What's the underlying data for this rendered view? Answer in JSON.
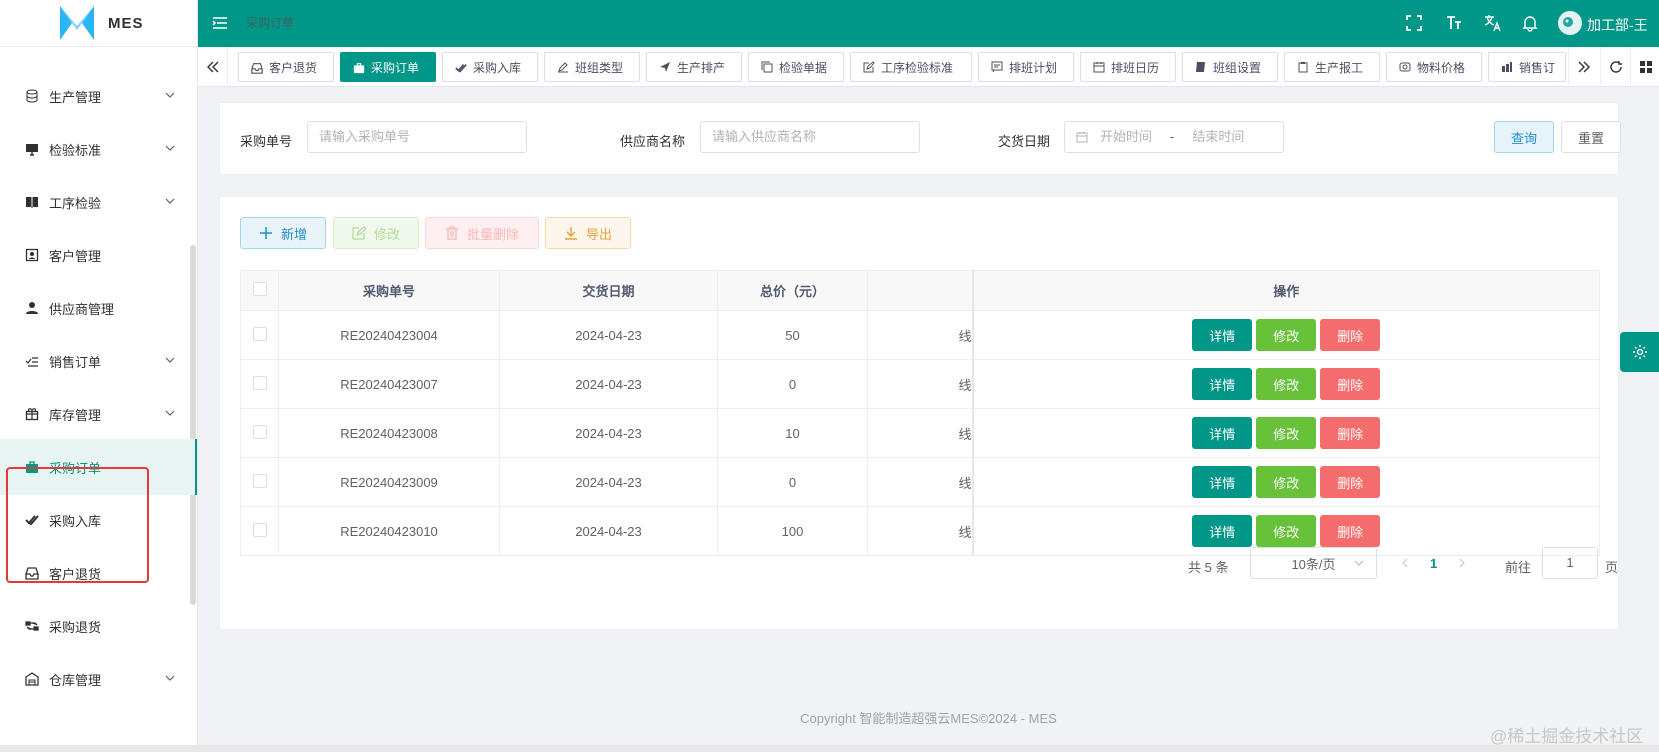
{
  "app": {
    "logo_text": "MES",
    "breadcrumb": "采购订单"
  },
  "user": {
    "name": "加工部-王"
  },
  "colors": {
    "primary": "#009688",
    "success": "#67c23a",
    "danger": "#f56c6c",
    "warning": "#e6a23c"
  },
  "sidebar": {
    "items": [
      {
        "label": "生产管理",
        "icon": "database-icon",
        "has_children": true
      },
      {
        "label": "检验标准",
        "icon": "monitor-icon",
        "has_children": true
      },
      {
        "label": "工序检验",
        "icon": "book-icon",
        "has_children": true
      },
      {
        "label": "客户管理",
        "icon": "contact-card-icon",
        "has_children": false
      },
      {
        "label": "供应商管理",
        "icon": "user-icon",
        "has_children": false
      },
      {
        "label": "销售订单",
        "icon": "list-check-icon",
        "has_children": true
      },
      {
        "label": "库存管理",
        "icon": "gift-box-icon",
        "has_children": true
      },
      {
        "label": "采购订单",
        "icon": "briefcase-icon",
        "has_children": false,
        "active": true
      },
      {
        "label": "采购入库",
        "icon": "double-check-icon",
        "has_children": false
      },
      {
        "label": "客户退货",
        "icon": "inbox-icon",
        "has_children": false
      },
      {
        "label": "采购退货",
        "icon": "swap-icon",
        "has_children": false
      },
      {
        "label": "仓库管理",
        "icon": "warehouse-icon",
        "has_children": true
      }
    ]
  },
  "tabs": [
    {
      "label": "客户退货",
      "icon": "inbox-icon"
    },
    {
      "label": "采购订单",
      "icon": "briefcase-icon",
      "active": true
    },
    {
      "label": "采购入库",
      "icon": "double-check-icon"
    },
    {
      "label": "班组类型",
      "icon": "pen-icon"
    },
    {
      "label": "生产排产",
      "icon": "send-icon"
    },
    {
      "label": "检验单据",
      "icon": "copy-icon"
    },
    {
      "label": "工序检验标准",
      "icon": "edit-icon"
    },
    {
      "label": "排班计划",
      "icon": "message-icon"
    },
    {
      "label": "排班日历",
      "icon": "calendar-icon"
    },
    {
      "label": "班组设置",
      "icon": "notebook-icon"
    },
    {
      "label": "生产报工",
      "icon": "clipboard-icon"
    },
    {
      "label": "物料价格",
      "icon": "tag-icon"
    },
    {
      "label": "销售订",
      "icon": "person-board-icon"
    }
  ],
  "search": {
    "order_no_label": "采购单号",
    "order_no_placeholder": "请输入采购单号",
    "supplier_label": "供应商名称",
    "supplier_placeholder": "请输入供应商名称",
    "date_label": "交货日期",
    "start_placeholder": "开始时间",
    "range_sep": "-",
    "end_placeholder": "结束时间",
    "query_button": "查询",
    "reset_button": "重置"
  },
  "toolbar": {
    "add": "新增",
    "edit": "修改",
    "batch_delete": "批量删除",
    "export": "导出"
  },
  "table": {
    "columns": [
      "采购单号",
      "交货日期",
      "总价（元）",
      "操作"
    ],
    "rows": [
      {
        "order_no": "RE20240423004",
        "date": "2024-04-23",
        "total": "50",
        "extra": "线"
      },
      {
        "order_no": "RE20240423007",
        "date": "2024-04-23",
        "total": "0",
        "extra": "线"
      },
      {
        "order_no": "RE20240423008",
        "date": "2024-04-23",
        "total": "10",
        "extra": "线"
      },
      {
        "order_no": "RE20240423009",
        "date": "2024-04-23",
        "total": "0",
        "extra": "线"
      },
      {
        "order_no": "RE20240423010",
        "date": "2024-04-23",
        "total": "100",
        "extra": "线"
      }
    ],
    "actions": {
      "detail": "详情",
      "edit": "修改",
      "delete": "删除"
    }
  },
  "pagination": {
    "total_text": "共 5 条",
    "page_size": "10条/页",
    "current": "1",
    "goto_label": "前往",
    "goto_value": "1",
    "page_suffix": "页"
  },
  "footer": {
    "text": "Copyright 智能制造超强云MES©2024 - MES"
  },
  "watermark": "@稀土掘金技术社区"
}
